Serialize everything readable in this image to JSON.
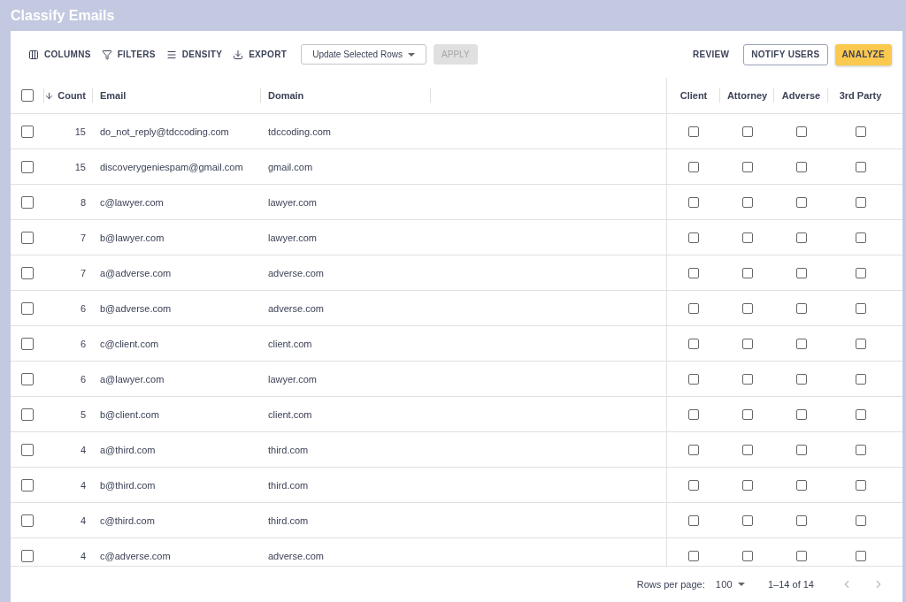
{
  "title": "Classify Emails",
  "toolbar": {
    "tools": [
      {
        "kind": "columns",
        "label": "COLUMNS"
      },
      {
        "kind": "filters",
        "label": "FILTERS"
      },
      {
        "kind": "density",
        "label": "DENSITY"
      },
      {
        "kind": "export",
        "label": "EXPORT"
      }
    ],
    "bulk_select": {
      "value": "Update Selected Rows"
    },
    "apply": {
      "label": "APPLY",
      "disabled": true
    },
    "actions": [
      {
        "kind": "text",
        "label": "REVIEW"
      },
      {
        "kind": "outlined",
        "label": "NOTIFY USERS"
      },
      {
        "kind": "primary",
        "label": "ANALYZE"
      }
    ]
  },
  "table": {
    "select_all": {
      "checked": false
    },
    "columns": [
      {
        "label": "Count",
        "sorted": true
      },
      {
        "label": "Email",
        "sorted": false
      },
      {
        "label": "Domain",
        "sorted": false
      }
    ],
    "class_columns": [
      "Client",
      "Attorney",
      "Adverse",
      "3rd Party"
    ],
    "rows": [
      {
        "selected": false,
        "count": "15",
        "email": "do_not_reply@tdccoding.com",
        "domain": "tdccoding.com",
        "classes": [
          false,
          false,
          false,
          false
        ]
      },
      {
        "selected": false,
        "count": "15",
        "email": "discoverygeniespam@gmail.com",
        "domain": "gmail.com",
        "classes": [
          false,
          false,
          false,
          false
        ]
      },
      {
        "selected": false,
        "count": "8",
        "email": "c@lawyer.com",
        "domain": "lawyer.com",
        "classes": [
          false,
          false,
          false,
          false
        ]
      },
      {
        "selected": false,
        "count": "7",
        "email": "b@lawyer.com",
        "domain": "lawyer.com",
        "classes": [
          false,
          false,
          false,
          false
        ]
      },
      {
        "selected": false,
        "count": "7",
        "email": "a@adverse.com",
        "domain": "adverse.com",
        "classes": [
          false,
          false,
          false,
          false
        ]
      },
      {
        "selected": false,
        "count": "6",
        "email": "b@adverse.com",
        "domain": "adverse.com",
        "classes": [
          false,
          false,
          false,
          false
        ]
      },
      {
        "selected": false,
        "count": "6",
        "email": "c@client.com",
        "domain": "client.com",
        "classes": [
          false,
          false,
          false,
          false
        ]
      },
      {
        "selected": false,
        "count": "6",
        "email": "a@lawyer.com",
        "domain": "lawyer.com",
        "classes": [
          false,
          false,
          false,
          false
        ]
      },
      {
        "selected": false,
        "count": "5",
        "email": "b@client.com",
        "domain": "client.com",
        "classes": [
          false,
          false,
          false,
          false
        ]
      },
      {
        "selected": false,
        "count": "4",
        "email": "a@third.com",
        "domain": "third.com",
        "classes": [
          false,
          false,
          false,
          false
        ]
      },
      {
        "selected": false,
        "count": "4",
        "email": "b@third.com",
        "domain": "third.com",
        "classes": [
          false,
          false,
          false,
          false
        ]
      },
      {
        "selected": false,
        "count": "4",
        "email": "c@third.com",
        "domain": "third.com",
        "classes": [
          false,
          false,
          false,
          false
        ]
      },
      {
        "selected": false,
        "count": "4",
        "email": "c@adverse.com",
        "domain": "adverse.com",
        "classes": [
          false,
          false,
          false,
          false
        ]
      }
    ]
  },
  "pagination": {
    "rows_per_page_label": "Rows per page:",
    "rows_per_page": "100",
    "range": "1–14 of 14",
    "prev_disabled": true,
    "next_disabled": true
  }
}
